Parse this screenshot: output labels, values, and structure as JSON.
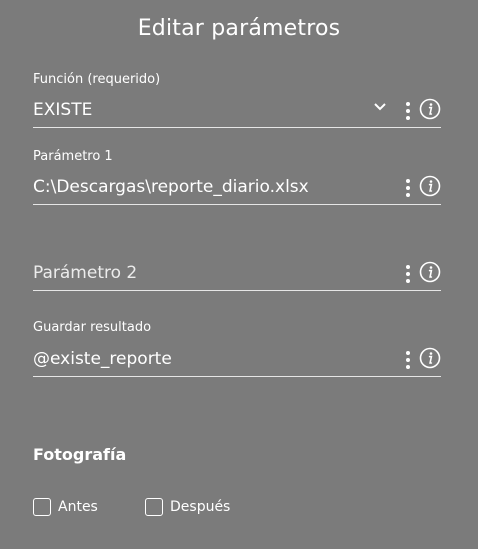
{
  "dialog": {
    "title": "Editar parámetros"
  },
  "fields": {
    "funcion": {
      "label": "Función (requerido)",
      "value": "EXISTE",
      "icons": [
        "chevron-down-icon",
        "more-vert-icon",
        "info-icon"
      ]
    },
    "parametro1": {
      "label": "Parámetro 1",
      "value": "C:\\Descargas\\reporte_diario.xlsx",
      "icons": [
        "more-vert-icon",
        "info-icon"
      ]
    },
    "parametro2": {
      "placeholder": "Parámetro 2",
      "icons": [
        "more-vert-icon",
        "info-icon"
      ]
    },
    "guardar": {
      "label": "Guardar resultado",
      "value": "@existe_reporte",
      "icons": [
        "more-vert-icon",
        "info-icon"
      ]
    }
  },
  "fotografia": {
    "title": "Fotografía",
    "options": [
      {
        "label": "Antes",
        "checked": false
      },
      {
        "label": "Después",
        "checked": false
      }
    ]
  },
  "colors": {
    "background": "#7b7b7b",
    "text": "#ffffff",
    "underline": "#e6e6e6"
  }
}
